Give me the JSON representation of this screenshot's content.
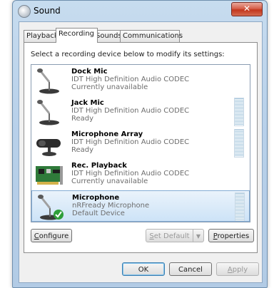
{
  "window": {
    "title": "Sound",
    "close_glyph": "✕"
  },
  "tabs": [
    {
      "label": "Playback"
    },
    {
      "label": "Recording"
    },
    {
      "label": "Sounds"
    },
    {
      "label": "Communications"
    }
  ],
  "instruction": "Select a recording device below to modify its settings:",
  "devices": [
    {
      "name": "Dock Mic",
      "driver": "IDT High Definition Audio CODEC",
      "status": "Currently unavailable",
      "icon": "microphone-icon",
      "meter": false,
      "selected": false
    },
    {
      "name": "Jack Mic",
      "driver": "IDT High Definition Audio CODEC",
      "status": "Ready",
      "icon": "microphone-icon",
      "meter": true,
      "selected": false
    },
    {
      "name": "Microphone Array",
      "driver": "IDT High Definition Audio CODEC",
      "status": "Ready",
      "icon": "microphone-array-icon",
      "meter": true,
      "selected": false
    },
    {
      "name": "Rec. Playback",
      "driver": "IDT High Definition Audio CODEC",
      "status": "Currently unavailable",
      "icon": "sound-card-icon",
      "meter": false,
      "selected": false
    },
    {
      "name": "Microphone",
      "driver": "nRFready Microphone",
      "status": "Default Device",
      "icon": "microphone-default-icon",
      "meter": true,
      "selected": true
    }
  ],
  "buttons": {
    "configure": {
      "first": "C",
      "rest": "onfigure"
    },
    "set_default": {
      "first": "S",
      "rest": "et Default"
    },
    "properties": {
      "first": "P",
      "rest": "roperties"
    },
    "ok": "OK",
    "cancel": "Cancel",
    "apply": {
      "first": "A",
      "rest": "pply"
    }
  },
  "colors": {
    "selected_row": "#cde3f7",
    "close_button": "#c2361d",
    "titlebar": "#b9d1ea"
  }
}
